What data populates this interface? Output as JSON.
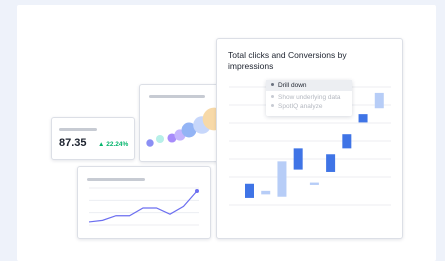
{
  "kpi": {
    "value": "87.35",
    "delta": "▲ 22.24%",
    "delta_color": "#06b56d"
  },
  "main_chart": {
    "title": "Total clicks and Conversions by impressions",
    "context_menu": [
      "Drill down",
      "Show underlying data",
      "SpotIQ analyze"
    ]
  },
  "colors": {
    "accent": "#3f74e6",
    "accent_light": "#b7cdf7",
    "line": "#6c6ff0"
  },
  "chart_data": [
    {
      "type": "line",
      "x": [
        1,
        2,
        3,
        4,
        5,
        6,
        7,
        8,
        9
      ],
      "values": [
        1,
        1.5,
        3,
        3,
        5.5,
        5.5,
        3.5,
        6,
        11
      ]
    },
    {
      "type": "bar",
      "title": "Total clicks and Conversions by impressions",
      "series": [
        {
          "values": [
            0.6,
            0.9,
            0.7,
            3.0,
            1.7,
            2.8,
            4.8,
            7.0,
            8.2
          ]
        },
        {
          "values": [
            1.2,
            0.3,
            3.0,
            1.8,
            0.2,
            1.5,
            1.2,
            0.7,
            1.3
          ]
        }
      ],
      "ylim": [
        0,
        10
      ]
    },
    {
      "type": "scatter",
      "values": [
        1,
        1.2,
        1.5,
        2.1,
        3.2,
        4.0,
        5.5
      ]
    }
  ]
}
